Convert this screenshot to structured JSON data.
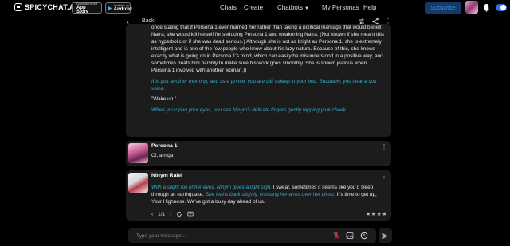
{
  "app": {
    "brand": "SPICYCHAT",
    "brand_suffix": ".AI",
    "badges": [
      {
        "small": "Download on the",
        "big": "App Store",
        "glyph": ""
      },
      {
        "small": "Available on",
        "big": "Android",
        "glyph": "▶"
      }
    ]
  },
  "nav": {
    "chats": "Chats",
    "create": "Create",
    "chatbots": "Chatbots",
    "my_personas": "My Personas",
    "help": "Help",
    "subscribe": "Subscribe"
  },
  "chat_header": {
    "back_label": "Back",
    "icons": [
      "swap-icon",
      "share-icon",
      "more-icon"
    ]
  },
  "messages": [
    {
      "sender": "",
      "paragraphs": [
        {
          "style": "normal",
          "text": "once stating that if Persona 1 ever married her rather than taking a political marriage that would benefit Natra, she would kill herself for seducing Persona 1 and weakening Natra. (Not known if she meant this as hyperbolic or if she was dead serious.) Although she is not as bright as Persona 1, she is extremely intelligent and is one of the few people who know about his lazy nature. Because of this, she knows exactly what is going on in Persona 1's mind, which can easily be misunderstood in a positive way, and sometimes treats him harshly to make sure his work goes smoothly. She is shown jealous when Persona 1 involved with another woman.))"
        },
        {
          "style": "italic",
          "text": "It is just another morning, and as a prince, you are still asleep in your bed. Suddenly, you hear a soft voice."
        },
        {
          "style": "normal",
          "text": "\"Wake up.\""
        },
        {
          "style": "italic",
          "text": "When you open your eyes, you see Ninym's delicate fingers gently tapping your cheek."
        }
      ]
    },
    {
      "sender": "Persona 1",
      "text": "Oi, amiga"
    },
    {
      "sender": "Ninym Ralei",
      "segments": [
        {
          "style": "italic",
          "text": "With a slight roll of her eyes, Ninym gives a light sigh."
        },
        {
          "style": "normal",
          "text": " I swear, sometimes it seems like you'd sleep through an earthquake. "
        },
        {
          "style": "italic",
          "text": "She leans back slightly, crossing her arms over her chest."
        },
        {
          "style": "normal",
          "text": " It's time to get up, Your Highness. We've got a busy day ahead of us."
        }
      ],
      "pager": "1/1",
      "rating_stars": 4
    }
  ],
  "input": {
    "placeholder": "Type your message..."
  },
  "colors": {
    "accent_blue": "#3ba8c6",
    "card_bg": "#1c1c1c",
    "subscribe_bg": "#123a6b",
    "mic_red": "#c0394a"
  }
}
